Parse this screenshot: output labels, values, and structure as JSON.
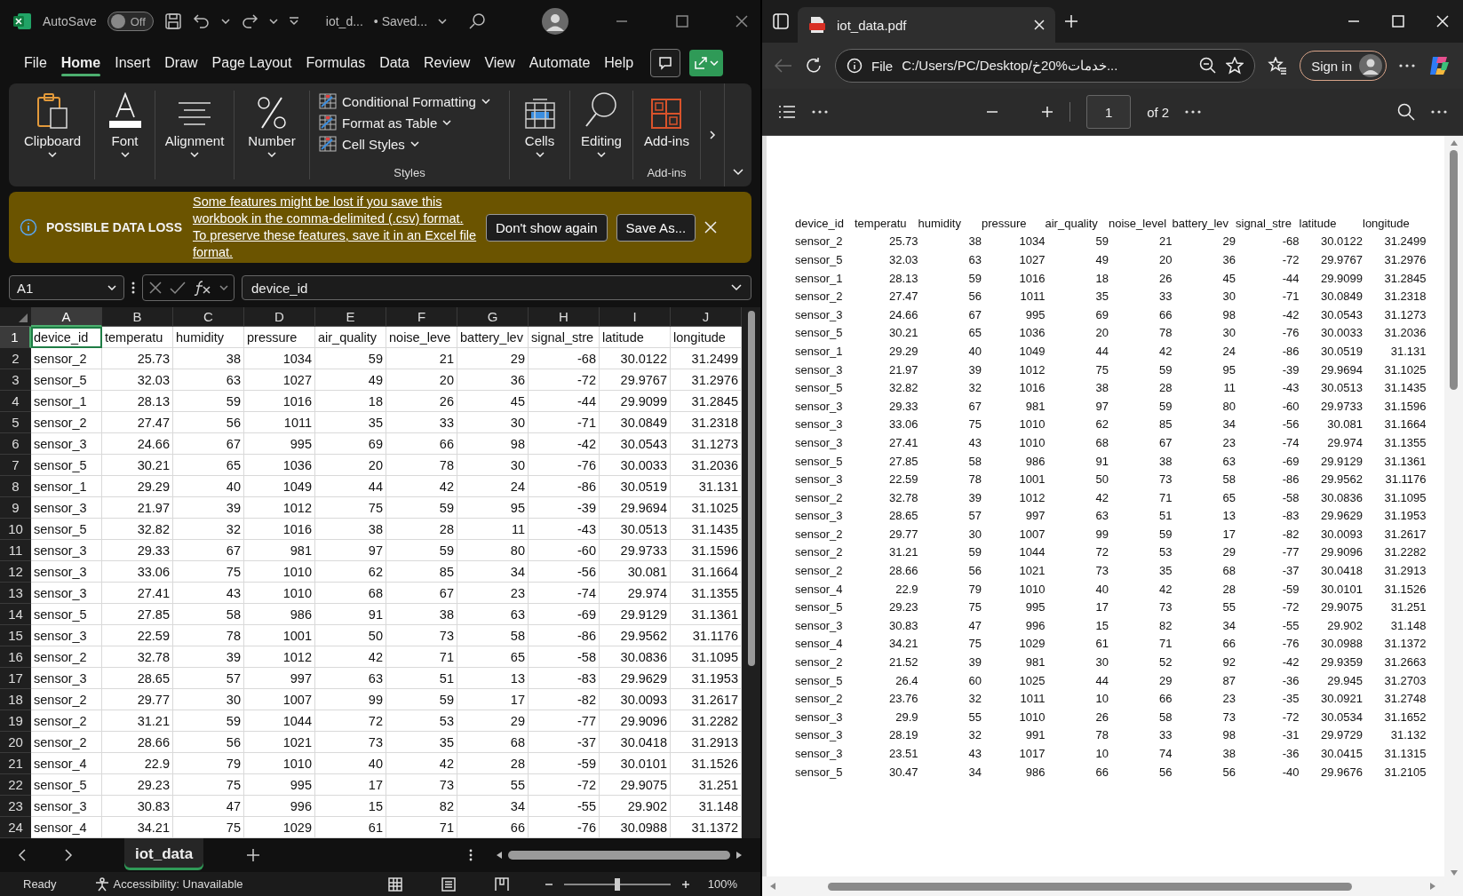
{
  "excel": {
    "title_bar": {
      "autosave_label": "AutoSave",
      "autosave_toggle": {
        "label": "Off",
        "on": false
      },
      "doc_title": "iot_d...",
      "save_status": "• Saved..."
    },
    "menu_tabs": [
      {
        "label": "File",
        "selected": false
      },
      {
        "label": "Home",
        "selected": true
      },
      {
        "label": "Insert",
        "selected": false
      },
      {
        "label": "Draw",
        "selected": false
      },
      {
        "label": "Page Layout",
        "selected": false
      },
      {
        "label": "Formulas",
        "selected": false
      },
      {
        "label": "Data",
        "selected": false
      },
      {
        "label": "Review",
        "selected": false
      },
      {
        "label": "View",
        "selected": false
      },
      {
        "label": "Automate",
        "selected": false
      },
      {
        "label": "Help",
        "selected": false
      }
    ],
    "ribbon_groups": [
      {
        "kind": "clipboard",
        "label": "Clipboard"
      },
      {
        "kind": "font",
        "label": "Font"
      },
      {
        "kind": "alignment",
        "label": "Alignment"
      },
      {
        "kind": "number",
        "label": "Number"
      },
      {
        "kind": "styles",
        "caption": "Styles",
        "items": [
          "Conditional Formatting",
          "Format as Table",
          "Cell Styles"
        ]
      },
      {
        "kind": "cells",
        "label": "Cells"
      },
      {
        "kind": "editing",
        "label": "Editing"
      },
      {
        "kind": "addins",
        "label": "Add-ins",
        "caption": "Add-ins"
      }
    ],
    "notice": {
      "title": "POSSIBLE DATA LOSS",
      "message": "Some features might be lost if you save this workbook in the comma-delimited (.csv) format. To preserve these features, save it in an Excel file format.",
      "buttons": [
        "Don't show again",
        "Save As..."
      ]
    },
    "name_box": "A1",
    "formula": "device_id",
    "columns": [
      {
        "letter": "A",
        "selected": true
      },
      {
        "letter": "B",
        "selected": false
      },
      {
        "letter": "C",
        "selected": false
      },
      {
        "letter": "D",
        "selected": false
      },
      {
        "letter": "E",
        "selected": false
      },
      {
        "letter": "F",
        "selected": false
      },
      {
        "letter": "G",
        "selected": false
      },
      {
        "letter": "H",
        "selected": false
      },
      {
        "letter": "I",
        "selected": false
      },
      {
        "letter": "J",
        "selected": false
      }
    ],
    "rows": [
      {
        "number": "1",
        "selected": true,
        "cells": [
          "device_id",
          "temperatu",
          "humidity",
          "pressure",
          "air_quality",
          "noise_leve",
          "battery_lev",
          "signal_stre",
          "latitude",
          "longitude"
        ]
      },
      {
        "number": "2",
        "selected": false,
        "cells": [
          "sensor_2",
          "25.73",
          "38",
          "1034",
          "59",
          "21",
          "29",
          "-68",
          "30.0122",
          "31.2499"
        ]
      },
      {
        "number": "3",
        "selected": false,
        "cells": [
          "sensor_5",
          "32.03",
          "63",
          "1027",
          "49",
          "20",
          "36",
          "-72",
          "29.9767",
          "31.2976"
        ]
      },
      {
        "number": "4",
        "selected": false,
        "cells": [
          "sensor_1",
          "28.13",
          "59",
          "1016",
          "18",
          "26",
          "45",
          "-44",
          "29.9099",
          "31.2845"
        ]
      },
      {
        "number": "5",
        "selected": false,
        "cells": [
          "sensor_2",
          "27.47",
          "56",
          "1011",
          "35",
          "33",
          "30",
          "-71",
          "30.0849",
          "31.2318"
        ]
      },
      {
        "number": "6",
        "selected": false,
        "cells": [
          "sensor_3",
          "24.66",
          "67",
          "995",
          "69",
          "66",
          "98",
          "-42",
          "30.0543",
          "31.1273"
        ]
      },
      {
        "number": "7",
        "selected": false,
        "cells": [
          "sensor_5",
          "30.21",
          "65",
          "1036",
          "20",
          "78",
          "30",
          "-76",
          "30.0033",
          "31.2036"
        ]
      },
      {
        "number": "8",
        "selected": false,
        "cells": [
          "sensor_1",
          "29.29",
          "40",
          "1049",
          "44",
          "42",
          "24",
          "-86",
          "30.0519",
          "31.131"
        ]
      },
      {
        "number": "9",
        "selected": false,
        "cells": [
          "sensor_3",
          "21.97",
          "39",
          "1012",
          "75",
          "59",
          "95",
          "-39",
          "29.9694",
          "31.1025"
        ]
      },
      {
        "number": "10",
        "selected": false,
        "cells": [
          "sensor_5",
          "32.82",
          "32",
          "1016",
          "38",
          "28",
          "11",
          "-43",
          "30.0513",
          "31.1435"
        ]
      },
      {
        "number": "11",
        "selected": false,
        "cells": [
          "sensor_3",
          "29.33",
          "67",
          "981",
          "97",
          "59",
          "80",
          "-60",
          "29.9733",
          "31.1596"
        ]
      },
      {
        "number": "12",
        "selected": false,
        "cells": [
          "sensor_3",
          "33.06",
          "75",
          "1010",
          "62",
          "85",
          "34",
          "-56",
          "30.081",
          "31.1664"
        ]
      },
      {
        "number": "13",
        "selected": false,
        "cells": [
          "sensor_3",
          "27.41",
          "43",
          "1010",
          "68",
          "67",
          "23",
          "-74",
          "29.974",
          "31.1355"
        ]
      },
      {
        "number": "14",
        "selected": false,
        "cells": [
          "sensor_5",
          "27.85",
          "58",
          "986",
          "91",
          "38",
          "63",
          "-69",
          "29.9129",
          "31.1361"
        ]
      },
      {
        "number": "15",
        "selected": false,
        "cells": [
          "sensor_3",
          "22.59",
          "78",
          "1001",
          "50",
          "73",
          "58",
          "-86",
          "29.9562",
          "31.1176"
        ]
      },
      {
        "number": "16",
        "selected": false,
        "cells": [
          "sensor_2",
          "32.78",
          "39",
          "1012",
          "42",
          "71",
          "65",
          "-58",
          "30.0836",
          "31.1095"
        ]
      },
      {
        "number": "17",
        "selected": false,
        "cells": [
          "sensor_3",
          "28.65",
          "57",
          "997",
          "63",
          "51",
          "13",
          "-83",
          "29.9629",
          "31.1953"
        ]
      },
      {
        "number": "18",
        "selected": false,
        "cells": [
          "sensor_2",
          "29.77",
          "30",
          "1007",
          "99",
          "59",
          "17",
          "-82",
          "30.0093",
          "31.2617"
        ]
      },
      {
        "number": "19",
        "selected": false,
        "cells": [
          "sensor_2",
          "31.21",
          "59",
          "1044",
          "72",
          "53",
          "29",
          "-77",
          "29.9096",
          "31.2282"
        ]
      },
      {
        "number": "20",
        "selected": false,
        "cells": [
          "sensor_2",
          "28.66",
          "56",
          "1021",
          "73",
          "35",
          "68",
          "-37",
          "30.0418",
          "31.2913"
        ]
      },
      {
        "number": "21",
        "selected": false,
        "cells": [
          "sensor_4",
          "22.9",
          "79",
          "1010",
          "40",
          "42",
          "28",
          "-59",
          "30.0101",
          "31.1526"
        ]
      },
      {
        "number": "22",
        "selected": false,
        "cells": [
          "sensor_5",
          "29.23",
          "75",
          "995",
          "17",
          "73",
          "55",
          "-72",
          "29.9075",
          "31.251"
        ]
      },
      {
        "number": "23",
        "selected": false,
        "cells": [
          "sensor_3",
          "30.83",
          "47",
          "996",
          "15",
          "82",
          "34",
          "-55",
          "29.902",
          "31.148"
        ]
      },
      {
        "number": "24",
        "selected": false,
        "cells": [
          "sensor_4",
          "34.21",
          "75",
          "1029",
          "61",
          "71",
          "66",
          "-76",
          "30.0988",
          "31.1372"
        ]
      }
    ],
    "sheet_tabs": [
      {
        "label": "iot_data",
        "selected": true
      }
    ],
    "status_bar": {
      "status": "Ready",
      "accessibility": "Accessibility: Unavailable",
      "zoom_slider": {
        "level": 0.5
      },
      "zoom": "100%"
    }
  },
  "browser": {
    "tab_title": "iot_data.pdf",
    "back": {
      "disabled": true
    },
    "address": {
      "scheme": "File",
      "url": "C:/Users/PC/Desktop/خدمات%20خ..."
    },
    "sign_in": "Sign in",
    "pdf_toolbar": {
      "page": "1",
      "page_count": "of 2"
    },
    "pdf_table": {
      "columns": [
        "device_id",
        "temperatu",
        "humidity",
        "pressure",
        "air_quality",
        "noise_level",
        "battery_lev",
        "signal_stre",
        "latitude",
        "longitude"
      ],
      "rows": [
        [
          "sensor_2",
          "25.73",
          "38",
          "1034",
          "59",
          "21",
          "29",
          "-68",
          "30.0122",
          "31.2499"
        ],
        [
          "sensor_5",
          "32.03",
          "63",
          "1027",
          "49",
          "20",
          "36",
          "-72",
          "29.9767",
          "31.2976"
        ],
        [
          "sensor_1",
          "28.13",
          "59",
          "1016",
          "18",
          "26",
          "45",
          "-44",
          "29.9099",
          "31.2845"
        ],
        [
          "sensor_2",
          "27.47",
          "56",
          "1011",
          "35",
          "33",
          "30",
          "-71",
          "30.0849",
          "31.2318"
        ],
        [
          "sensor_3",
          "24.66",
          "67",
          "995",
          "69",
          "66",
          "98",
          "-42",
          "30.0543",
          "31.1273"
        ],
        [
          "sensor_5",
          "30.21",
          "65",
          "1036",
          "20",
          "78",
          "30",
          "-76",
          "30.0033",
          "31.2036"
        ],
        [
          "sensor_1",
          "29.29",
          "40",
          "1049",
          "44",
          "42",
          "24",
          "-86",
          "30.0519",
          "31.131"
        ],
        [
          "sensor_3",
          "21.97",
          "39",
          "1012",
          "75",
          "59",
          "95",
          "-39",
          "29.9694",
          "31.1025"
        ],
        [
          "sensor_5",
          "32.82",
          "32",
          "1016",
          "38",
          "28",
          "11",
          "-43",
          "30.0513",
          "31.1435"
        ],
        [
          "sensor_3",
          "29.33",
          "67",
          "981",
          "97",
          "59",
          "80",
          "-60",
          "29.9733",
          "31.1596"
        ],
        [
          "sensor_3",
          "33.06",
          "75",
          "1010",
          "62",
          "85",
          "34",
          "-56",
          "30.081",
          "31.1664"
        ],
        [
          "sensor_3",
          "27.41",
          "43",
          "1010",
          "68",
          "67",
          "23",
          "-74",
          "29.974",
          "31.1355"
        ],
        [
          "sensor_5",
          "27.85",
          "58",
          "986",
          "91",
          "38",
          "63",
          "-69",
          "29.9129",
          "31.1361"
        ],
        [
          "sensor_3",
          "22.59",
          "78",
          "1001",
          "50",
          "73",
          "58",
          "-86",
          "29.9562",
          "31.1176"
        ],
        [
          "sensor_2",
          "32.78",
          "39",
          "1012",
          "42",
          "71",
          "65",
          "-58",
          "30.0836",
          "31.1095"
        ],
        [
          "sensor_3",
          "28.65",
          "57",
          "997",
          "63",
          "51",
          "13",
          "-83",
          "29.9629",
          "31.1953"
        ],
        [
          "sensor_2",
          "29.77",
          "30",
          "1007",
          "99",
          "59",
          "17",
          "-82",
          "30.0093",
          "31.2617"
        ],
        [
          "sensor_2",
          "31.21",
          "59",
          "1044",
          "72",
          "53",
          "29",
          "-77",
          "29.9096",
          "31.2282"
        ],
        [
          "sensor_2",
          "28.66",
          "56",
          "1021",
          "73",
          "35",
          "68",
          "-37",
          "30.0418",
          "31.2913"
        ],
        [
          "sensor_4",
          "22.9",
          "79",
          "1010",
          "40",
          "42",
          "28",
          "-59",
          "30.0101",
          "31.1526"
        ],
        [
          "sensor_5",
          "29.23",
          "75",
          "995",
          "17",
          "73",
          "55",
          "-72",
          "29.9075",
          "31.251"
        ],
        [
          "sensor_3",
          "30.83",
          "47",
          "996",
          "15",
          "82",
          "34",
          "-55",
          "29.902",
          "31.148"
        ],
        [
          "sensor_4",
          "34.21",
          "75",
          "1029",
          "61",
          "71",
          "66",
          "-76",
          "30.0988",
          "31.1372"
        ],
        [
          "sensor_2",
          "21.52",
          "39",
          "981",
          "30",
          "52",
          "92",
          "-42",
          "29.9359",
          "31.2663"
        ],
        [
          "sensor_5",
          "26.4",
          "60",
          "1025",
          "44",
          "29",
          "87",
          "-36",
          "29.945",
          "31.2703"
        ],
        [
          "sensor_2",
          "23.76",
          "32",
          "1011",
          "10",
          "66",
          "23",
          "-35",
          "30.0921",
          "31.2748"
        ],
        [
          "sensor_3",
          "29.9",
          "55",
          "1010",
          "26",
          "58",
          "73",
          "-72",
          "30.0534",
          "31.1652"
        ],
        [
          "sensor_3",
          "28.19",
          "32",
          "991",
          "78",
          "33",
          "98",
          "-31",
          "29.9729",
          "31.132"
        ],
        [
          "sensor_3",
          "23.51",
          "43",
          "1017",
          "10",
          "74",
          "38",
          "-36",
          "30.0415",
          "31.1315"
        ],
        [
          "sensor_5",
          "30.47",
          "34",
          "986",
          "66",
          "56",
          "56",
          "-40",
          "29.9676",
          "31.2105"
        ]
      ]
    }
  }
}
